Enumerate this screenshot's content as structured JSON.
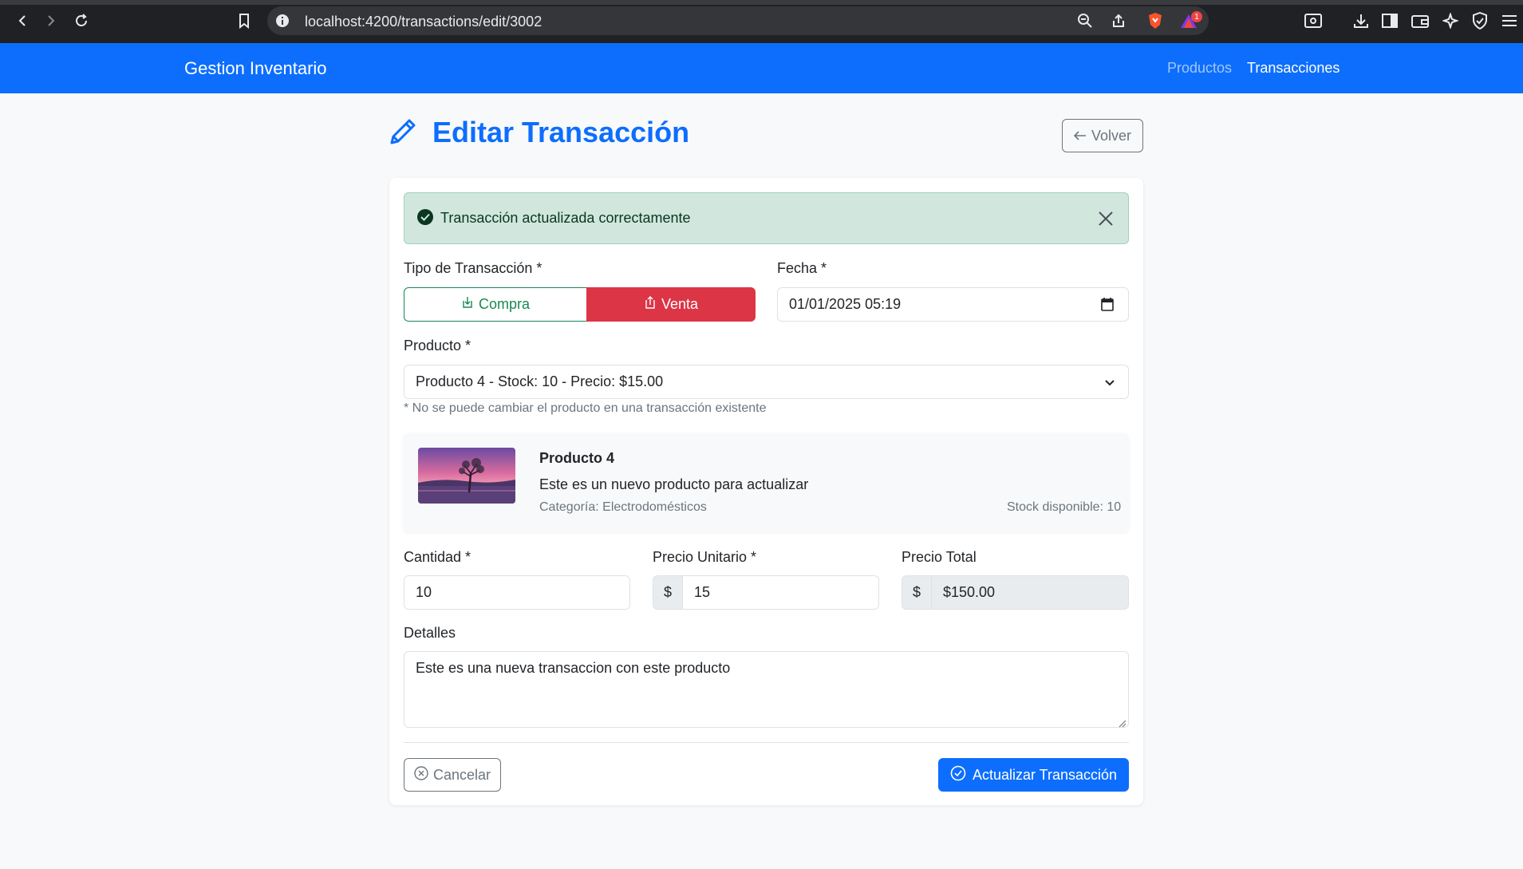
{
  "browser": {
    "url": "localhost:4200/transactions/edit/3002",
    "brave_badge_count": "1"
  },
  "navbar": {
    "brand": "Gestion Inventario",
    "links": [
      {
        "label": "Productos",
        "active": false
      },
      {
        "label": "Transacciones",
        "active": true
      }
    ]
  },
  "page": {
    "title": "Editar Transacción",
    "back_label": "Volver"
  },
  "alert": {
    "message": "Transacción actualizada correctamente"
  },
  "form": {
    "type_label": "Tipo de Transacción *",
    "type_options": {
      "compra": "Compra",
      "venta": "Venta"
    },
    "selected_type": "venta",
    "date_label": "Fecha *",
    "date_value": "01/01/2025 05:19",
    "product_label": "Producto *",
    "product_value": "Producto 4 - Stock: 10 - Precio: $15.00",
    "product_note": "* No se puede cambiar el producto en una transacción existente",
    "quantity_label": "Cantidad *",
    "quantity_value": "10",
    "unit_price_label": "Precio Unitario *",
    "unit_price_value": "15",
    "currency": "$",
    "total_label": "Precio Total",
    "total_value": "$150.00",
    "details_label": "Detalles",
    "details_value": "Este es una nueva transaccion con este producto",
    "cancel_label": "Cancelar",
    "submit_label": "Actualizar Transacción"
  },
  "product_card": {
    "name": "Producto 4",
    "description": "Este es un nuevo producto para actualizar",
    "category": "Categoría: Electrodomésticos",
    "stock": "Stock disponible: 10"
  },
  "colors": {
    "primary": "#0d6efd",
    "success": "#198754",
    "danger": "#dc3545",
    "alert_bg": "#d1e7dd"
  }
}
